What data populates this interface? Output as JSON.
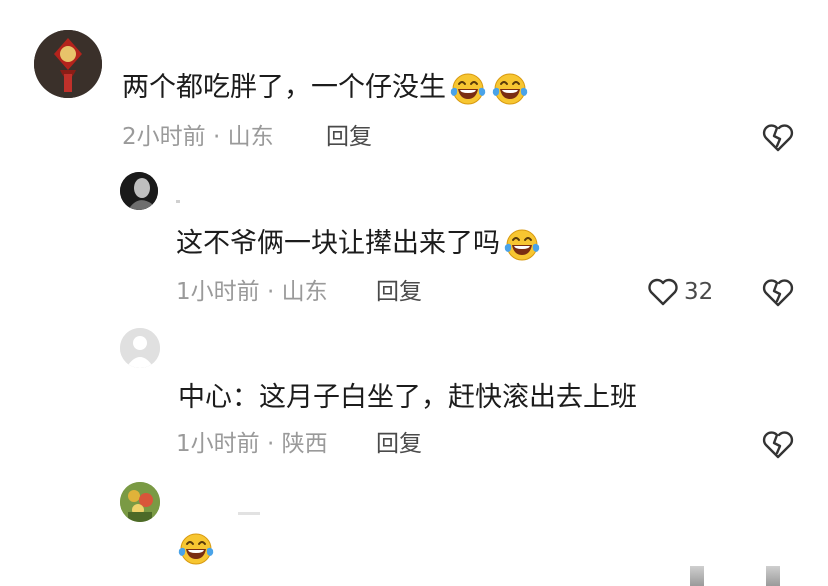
{
  "comments": [
    {
      "text": "两个都吃胖了，一个仔没生",
      "emoji_count": 2,
      "time": "2小时前",
      "location": "山东",
      "reply_label": "回复"
    },
    {
      "text": "这不爷俩一块让撵出来了吗",
      "emoji_count": 1,
      "time": "1小时前",
      "location": "山东",
      "reply_label": "回复",
      "likes": "32"
    },
    {
      "text": "中心：这月子白坐了，赶快滚出去上班",
      "emoji_count": 0,
      "time": "1小时前",
      "location": "陕西",
      "reply_label": "回复"
    },
    {
      "emoji_count": 1
    }
  ],
  "separator": " · ",
  "icons": {
    "emoji": "laughing-tears-emoji",
    "dislike": "broken-heart-icon",
    "like": "heart-outline-icon"
  },
  "colors": {
    "text": "#1c1c1c",
    "meta": "#9a9a9a",
    "emoji_face": "#f7c631",
    "tears": "#4aa3e8"
  }
}
